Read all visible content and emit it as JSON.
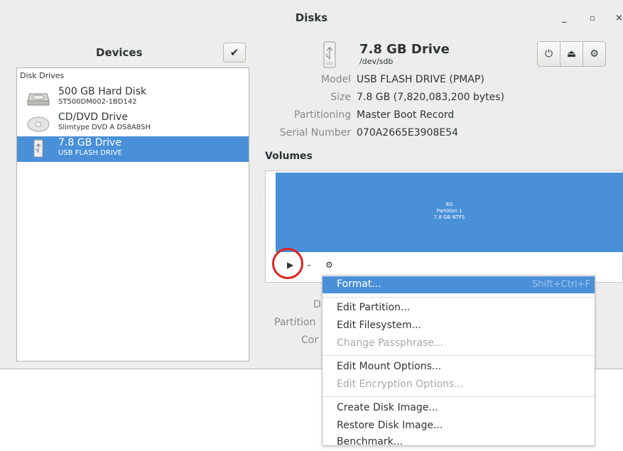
{
  "window": {
    "title": "Disks",
    "controls": {
      "minimize": "_",
      "maximize": "▫",
      "close": "×"
    }
  },
  "sidebar": {
    "title": "Devices",
    "check_icon": "✔",
    "heading": "Disk Drives",
    "drives": [
      {
        "name": "500 GB Hard Disk",
        "sub": "ST500DM002-1BD142",
        "icon": "hard-disk-icon"
      },
      {
        "name": "CD/DVD Drive",
        "sub": "Slimtype DVD A  DS8A8SH",
        "icon": "optical-drive-icon"
      },
      {
        "name": "7.8 GB Drive",
        "sub": "USB FLASH DRIVE",
        "icon": "usb-drive-icon",
        "selected": true
      }
    ]
  },
  "drive": {
    "title": "7.8 GB Drive",
    "path": "/dev/sdb",
    "buttons": {
      "power": "⏻",
      "eject": "⏏",
      "settings": "⚙"
    },
    "properties": [
      {
        "label": "Model",
        "value": "USB FLASH DRIVE (PMAP)"
      },
      {
        "label": "Size",
        "value": "7.8 GB (7,820,083,200 bytes)"
      },
      {
        "label": "Partitioning",
        "value": "Master Boot Record"
      },
      {
        "label": "Serial Number",
        "value": "070A2665E3908E54"
      }
    ]
  },
  "volumes": {
    "title": "Volumes",
    "partition": {
      "line1": "8G",
      "line2": "Partition 1",
      "line3": "7.8 GB NTFS"
    },
    "toolbar": {
      "play": "▶",
      "minus": "–",
      "gears": "⚙"
    },
    "partial_labels": [
      "D",
      "Partition",
      "Cor"
    ]
  },
  "menu": {
    "items": [
      {
        "label": "Format...",
        "accel": "Shift+Ctrl+F",
        "state": "active"
      },
      {
        "label": "Edit Partition...",
        "state": "normal"
      },
      {
        "label": "Edit Filesystem...",
        "state": "normal"
      },
      {
        "label": "Change Passphrase...",
        "state": "disabled"
      },
      {
        "label": "Edit Mount Options...",
        "state": "normal"
      },
      {
        "label": "Edit Encryption Options...",
        "state": "disabled"
      },
      {
        "label": "Create Disk Image...",
        "state": "normal"
      },
      {
        "label": "Restore Disk Image...",
        "state": "normal"
      },
      {
        "label": "Benchmark...",
        "state": "normal"
      }
    ]
  }
}
